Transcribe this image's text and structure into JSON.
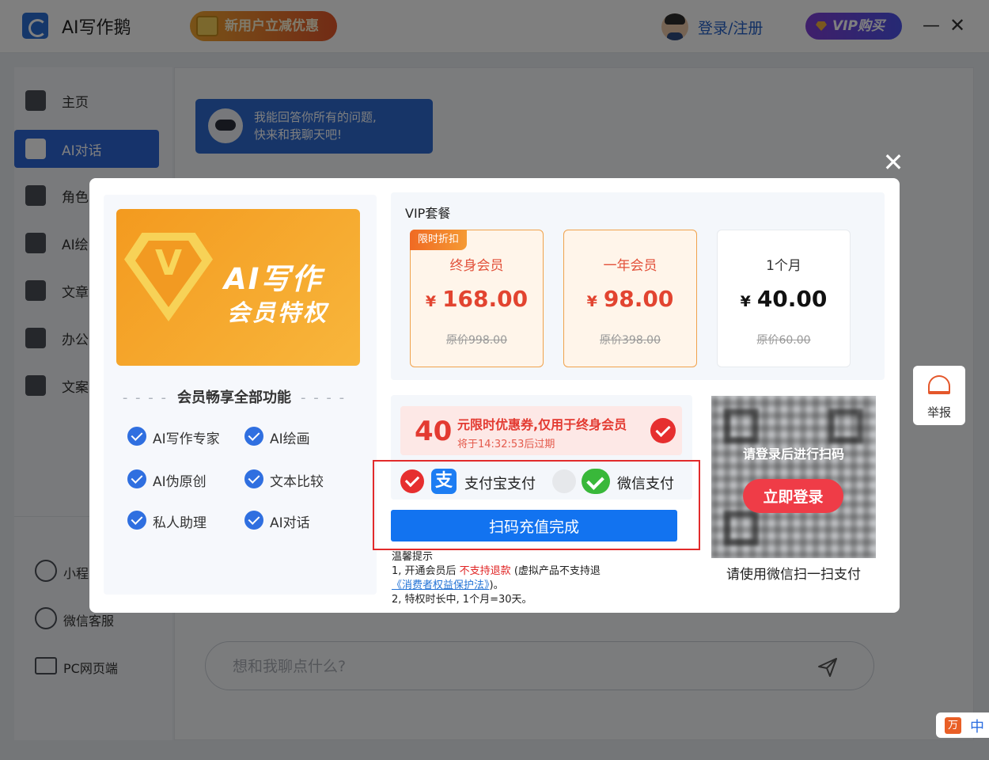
{
  "titlebar": {
    "app_title": "AI写作鹅",
    "promo_label": "新用户立减优惠",
    "login_label": "登录/注册",
    "vip_label": "VIP购买",
    "minimize_glyph": "—",
    "close_glyph": "✕"
  },
  "sidebar": {
    "items": [
      {
        "label": "主页",
        "icon": "home-icon"
      },
      {
        "label": "AI对话",
        "icon": "chat-icon",
        "active": true
      },
      {
        "label": "角色",
        "icon": "role-icon"
      },
      {
        "label": "AI绘",
        "icon": "palette-icon"
      },
      {
        "label": "文章",
        "icon": "bulb-icon"
      },
      {
        "label": "办公",
        "icon": "edit-icon"
      },
      {
        "label": "文案",
        "icon": "translate-icon"
      }
    ],
    "bottom_items": [
      {
        "label": "小程",
        "icon": "miniprogram-icon"
      },
      {
        "label": "微信客服",
        "icon": "wechat-service-icon"
      },
      {
        "label": "PC网页端",
        "icon": "screen-icon"
      }
    ]
  },
  "main": {
    "bot_message_line1": "我能回答你所有的问题,",
    "bot_message_line2": "快来和我聊天吧!",
    "chat_placeholder": "想和我聊点什么?"
  },
  "modal": {
    "close_glyph": "✕",
    "banner_title": "AI写作",
    "banner_subtitle": "会员特权",
    "banner_v": "V",
    "features_heading": "会员畅享全部功能",
    "features": [
      "AI写作专家",
      "AI绘画",
      "AI伪原创",
      "文本比较",
      "私人助理",
      "AI对话"
    ],
    "vip_heading": "VIP套餐",
    "currency": "¥",
    "plans": [
      {
        "tag": "限时折扣",
        "name": "终身会员",
        "price": "168.00",
        "original": "原价998.00",
        "highlighted": true
      },
      {
        "tag": "",
        "name": "一年会员",
        "price": "98.00",
        "original": "原价398.00",
        "highlighted": true
      },
      {
        "tag": "",
        "name": "1个月",
        "price": "40.00",
        "original": "原价60.00",
        "highlighted": false
      }
    ],
    "coupon": {
      "amount": "40",
      "title": "元限时优惠券,仅用于终身会员",
      "expire": "将于14:32:53后过期"
    },
    "payment": {
      "alipay_label": "支付宝支付",
      "alipay_glyph": "支",
      "wechat_label": "微信支付",
      "selected": "alipay"
    },
    "confirm_label": "扫码充值完成",
    "tips": {
      "heading": "温馨提示",
      "line1_prefix": "1,  开通会员后 ",
      "line1_red": "不支持退款",
      "line1_suffix": " (虚拟产品不支持退",
      "line1_link": "《消费者权益保护法》",
      "line1_end": ")。",
      "line2": "2,  特权时长中,  1个月=30天。"
    },
    "qr": {
      "overlay_text": "请登录后进行扫码",
      "login_button": "立即登录",
      "caption": "请使用微信扫一扫支付"
    }
  },
  "floating": {
    "report_label": "举报",
    "ime_logo": "万",
    "ime_lang": "中"
  },
  "colors": {
    "accent": "#2c66d6",
    "price_red": "#e24430",
    "confirm_blue": "#1273f0",
    "highlight_red": "#e22b2b",
    "alipay_blue": "#1c7df3",
    "wechat_green": "#39b83a"
  }
}
